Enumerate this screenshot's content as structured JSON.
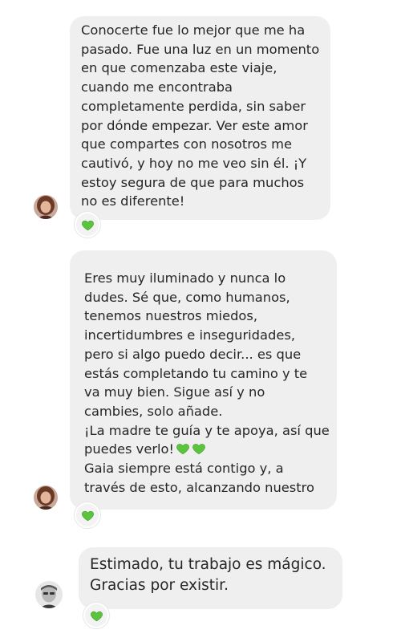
{
  "colors": {
    "bubble": "#efefef",
    "text": "#262626",
    "heart": "#5ac43c"
  },
  "messages": [
    {
      "text": "Conocerte fue lo mejor que me ha\npasado. Fue una luz en un momento\nen que comenzaba este viaje,\ncuando me encontraba\ncompletamente perdida, sin saber\npor dónde empezar. Ver este amor\nque compartes con nosotros me\ncautivó, y hoy no me veo sin él. ¡Y\nestoy segura de que para muchos\nno es diferente!",
      "reaction": "green-heart"
    },
    {
      "text_before_hearts": "Eres muy iluminado y nunca lo\ndudes. Sé que, como humanos,\ntenemos nuestros miedos,\nincertidumbres e inseguridades,\npero si algo puedo decir... es que\nestás completando tu camino y te\nva muy bien. Sigue así y no\ncambies, solo añade.\n¡La madre te guía y te apoya, así que\npuedes verlo!",
      "text_after_hearts": "\nGaia siempre está contigo y, a\ntravés de esto, alcanzando nuestro",
      "inline_emojis": [
        "green-heart",
        "green-heart"
      ],
      "reaction": "green-heart"
    },
    {
      "text": "Estimado, tu trabajo es mágico.\nGracias por existir.",
      "reaction": "green-heart"
    }
  ]
}
